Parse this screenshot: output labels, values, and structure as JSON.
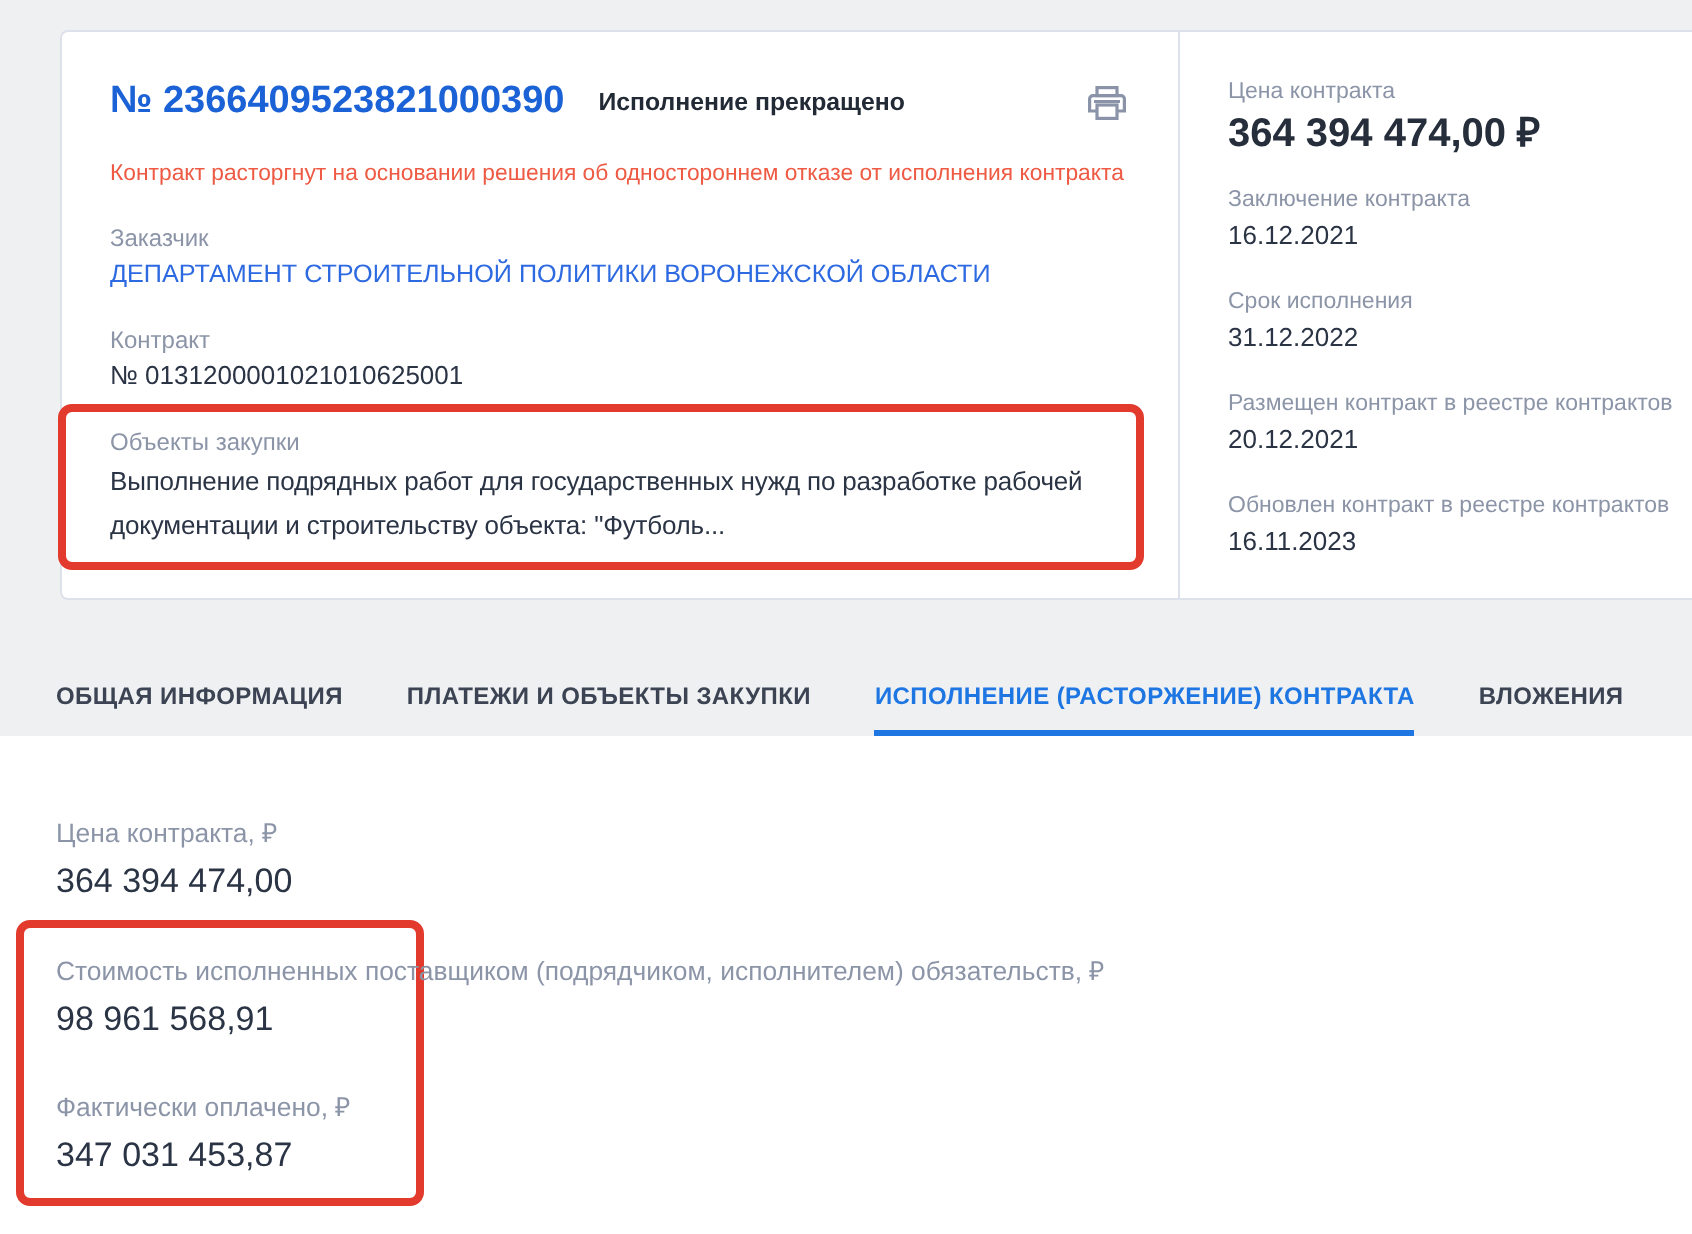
{
  "contract_card": {
    "number": "№ 2366409523821000390",
    "status": "Исполнение прекращено",
    "notice": "Контракт расторгнут на основании решения об одностороннем отказе от исполнения контракта",
    "fields": [
      {
        "label": "Заказчик",
        "value": "ДЕПАРТАМЕНТ СТРОИТЕЛЬНОЙ ПОЛИТИКИ ВОРОНЕЖСКОЙ ОБЛАСТИ",
        "kind": "link",
        "highlighted": false
      },
      {
        "label": "Контракт",
        "value": "№ 0131200001021010625001",
        "kind": "text",
        "highlighted": false
      },
      {
        "label": "Объекты закупки",
        "value": "Выполнение подрядных работ для государственных нужд по разработке рабочей документации и строительству объекта: \"Футболь...",
        "kind": "text",
        "highlighted": true
      }
    ]
  },
  "summary": {
    "price_label": "Цена контракта",
    "price": "364 394 474,00 ₽",
    "dates": [
      {
        "label": "Заключение контракта",
        "value": "16.12.2021"
      },
      {
        "label": "Срок исполнения",
        "value": "31.12.2022"
      },
      {
        "label": "Размещен контракт в реестре контрактов",
        "value": "20.12.2021"
      },
      {
        "label": "Обновлен контракт в реестре контрактов",
        "value": "16.11.2023"
      }
    ]
  },
  "tabs": [
    {
      "label": "ОБЩАЯ ИНФОРМАЦИЯ",
      "selected": false
    },
    {
      "label": "ПЛАТЕЖИ И ОБЪЕКТЫ ЗАКУПКИ",
      "selected": false
    },
    {
      "label": "ИСПОЛНЕНИЕ (РАСТОРЖЕНИЕ) КОНТРАКТА",
      "selected": true
    },
    {
      "label": "ВЛОЖЕНИЯ",
      "selected": false
    }
  ],
  "execution": {
    "fields": [
      {
        "label": "Цена контракта, ₽",
        "value": "364 394 474,00",
        "highlighted": false
      },
      {
        "label": "Стоимость исполненных поставщиком (подрядчиком, исполнителем) обязательств, ₽",
        "value": "98 961 568,91",
        "highlighted": true
      },
      {
        "label": "Фактически оплачено, ₽",
        "value": "347 031 453,87",
        "highlighted": true
      }
    ]
  }
}
